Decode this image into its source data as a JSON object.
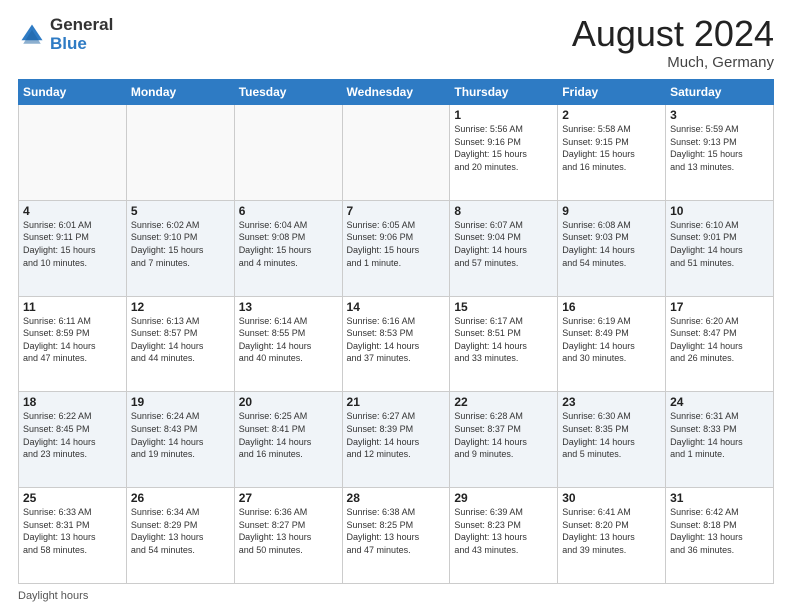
{
  "header": {
    "logo_general": "General",
    "logo_blue": "Blue",
    "month_title": "August 2024",
    "location": "Much, Germany"
  },
  "days_of_week": [
    "Sunday",
    "Monday",
    "Tuesday",
    "Wednesday",
    "Thursday",
    "Friday",
    "Saturday"
  ],
  "weeks": [
    [
      {
        "day": "",
        "info": ""
      },
      {
        "day": "",
        "info": ""
      },
      {
        "day": "",
        "info": ""
      },
      {
        "day": "",
        "info": ""
      },
      {
        "day": "1",
        "info": "Sunrise: 5:56 AM\nSunset: 9:16 PM\nDaylight: 15 hours\nand 20 minutes."
      },
      {
        "day": "2",
        "info": "Sunrise: 5:58 AM\nSunset: 9:15 PM\nDaylight: 15 hours\nand 16 minutes."
      },
      {
        "day": "3",
        "info": "Sunrise: 5:59 AM\nSunset: 9:13 PM\nDaylight: 15 hours\nand 13 minutes."
      }
    ],
    [
      {
        "day": "4",
        "info": "Sunrise: 6:01 AM\nSunset: 9:11 PM\nDaylight: 15 hours\nand 10 minutes."
      },
      {
        "day": "5",
        "info": "Sunrise: 6:02 AM\nSunset: 9:10 PM\nDaylight: 15 hours\nand 7 minutes."
      },
      {
        "day": "6",
        "info": "Sunrise: 6:04 AM\nSunset: 9:08 PM\nDaylight: 15 hours\nand 4 minutes."
      },
      {
        "day": "7",
        "info": "Sunrise: 6:05 AM\nSunset: 9:06 PM\nDaylight: 15 hours\nand 1 minute."
      },
      {
        "day": "8",
        "info": "Sunrise: 6:07 AM\nSunset: 9:04 PM\nDaylight: 14 hours\nand 57 minutes."
      },
      {
        "day": "9",
        "info": "Sunrise: 6:08 AM\nSunset: 9:03 PM\nDaylight: 14 hours\nand 54 minutes."
      },
      {
        "day": "10",
        "info": "Sunrise: 6:10 AM\nSunset: 9:01 PM\nDaylight: 14 hours\nand 51 minutes."
      }
    ],
    [
      {
        "day": "11",
        "info": "Sunrise: 6:11 AM\nSunset: 8:59 PM\nDaylight: 14 hours\nand 47 minutes."
      },
      {
        "day": "12",
        "info": "Sunrise: 6:13 AM\nSunset: 8:57 PM\nDaylight: 14 hours\nand 44 minutes."
      },
      {
        "day": "13",
        "info": "Sunrise: 6:14 AM\nSunset: 8:55 PM\nDaylight: 14 hours\nand 40 minutes."
      },
      {
        "day": "14",
        "info": "Sunrise: 6:16 AM\nSunset: 8:53 PM\nDaylight: 14 hours\nand 37 minutes."
      },
      {
        "day": "15",
        "info": "Sunrise: 6:17 AM\nSunset: 8:51 PM\nDaylight: 14 hours\nand 33 minutes."
      },
      {
        "day": "16",
        "info": "Sunrise: 6:19 AM\nSunset: 8:49 PM\nDaylight: 14 hours\nand 30 minutes."
      },
      {
        "day": "17",
        "info": "Sunrise: 6:20 AM\nSunset: 8:47 PM\nDaylight: 14 hours\nand 26 minutes."
      }
    ],
    [
      {
        "day": "18",
        "info": "Sunrise: 6:22 AM\nSunset: 8:45 PM\nDaylight: 14 hours\nand 23 minutes."
      },
      {
        "day": "19",
        "info": "Sunrise: 6:24 AM\nSunset: 8:43 PM\nDaylight: 14 hours\nand 19 minutes."
      },
      {
        "day": "20",
        "info": "Sunrise: 6:25 AM\nSunset: 8:41 PM\nDaylight: 14 hours\nand 16 minutes."
      },
      {
        "day": "21",
        "info": "Sunrise: 6:27 AM\nSunset: 8:39 PM\nDaylight: 14 hours\nand 12 minutes."
      },
      {
        "day": "22",
        "info": "Sunrise: 6:28 AM\nSunset: 8:37 PM\nDaylight: 14 hours\nand 9 minutes."
      },
      {
        "day": "23",
        "info": "Sunrise: 6:30 AM\nSunset: 8:35 PM\nDaylight: 14 hours\nand 5 minutes."
      },
      {
        "day": "24",
        "info": "Sunrise: 6:31 AM\nSunset: 8:33 PM\nDaylight: 14 hours\nand 1 minute."
      }
    ],
    [
      {
        "day": "25",
        "info": "Sunrise: 6:33 AM\nSunset: 8:31 PM\nDaylight: 13 hours\nand 58 minutes."
      },
      {
        "day": "26",
        "info": "Sunrise: 6:34 AM\nSunset: 8:29 PM\nDaylight: 13 hours\nand 54 minutes."
      },
      {
        "day": "27",
        "info": "Sunrise: 6:36 AM\nSunset: 8:27 PM\nDaylight: 13 hours\nand 50 minutes."
      },
      {
        "day": "28",
        "info": "Sunrise: 6:38 AM\nSunset: 8:25 PM\nDaylight: 13 hours\nand 47 minutes."
      },
      {
        "day": "29",
        "info": "Sunrise: 6:39 AM\nSunset: 8:23 PM\nDaylight: 13 hours\nand 43 minutes."
      },
      {
        "day": "30",
        "info": "Sunrise: 6:41 AM\nSunset: 8:20 PM\nDaylight: 13 hours\nand 39 minutes."
      },
      {
        "day": "31",
        "info": "Sunrise: 6:42 AM\nSunset: 8:18 PM\nDaylight: 13 hours\nand 36 minutes."
      }
    ]
  ],
  "footer": {
    "daylight_label": "Daylight hours"
  }
}
